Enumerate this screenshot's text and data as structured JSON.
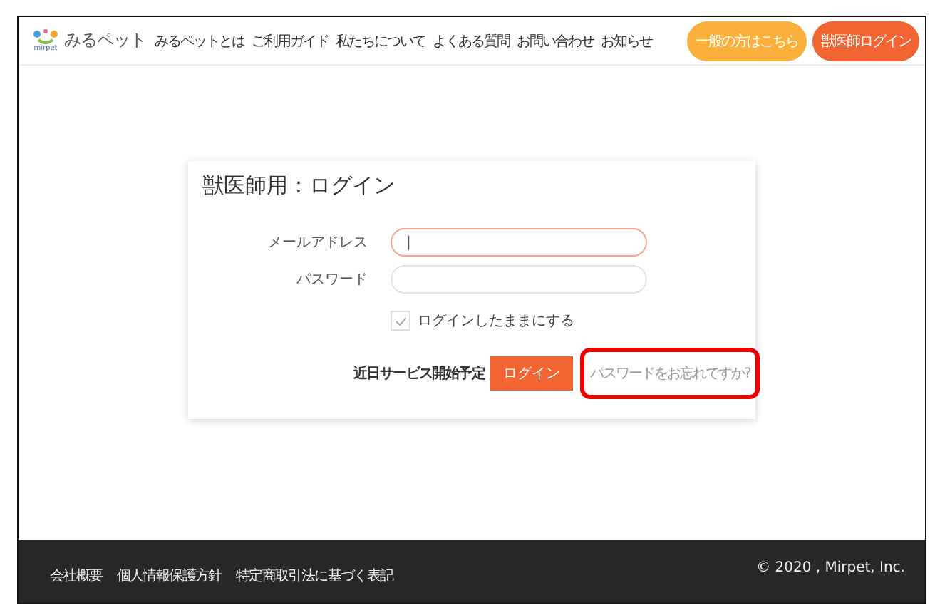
{
  "header": {
    "logo": {
      "wordmark": "みるペット",
      "sub": "mirpet"
    },
    "nav": [
      "みるペットとは",
      "ご利用ガイド",
      "私たちについて",
      "よくある質問",
      "お問い合わせ",
      "お知らせ"
    ],
    "buttons": [
      {
        "label": "一般の方はこちら",
        "kind": "general"
      },
      {
        "label": "獣医師ログイン",
        "kind": "vet"
      }
    ]
  },
  "login": {
    "title": "獣医師用：ログイン",
    "fields": [
      {
        "label": "メールアドレス",
        "value": "|",
        "focused": true
      },
      {
        "label": "パスワード",
        "focused": false
      }
    ],
    "remember": {
      "label": "ログインしたままにする",
      "checked": true
    },
    "notice": "近日サービス開始予定",
    "submit": "ログイン",
    "forgot": {
      "label": "パスワードをお忘れですか?",
      "highlighted": true
    }
  },
  "footer": {
    "links": [
      "会社概要",
      "個人情報保護方針",
      "特定商取引法に基づく表記"
    ],
    "copyright": "© 2020 , Mirpet, Inc."
  }
}
